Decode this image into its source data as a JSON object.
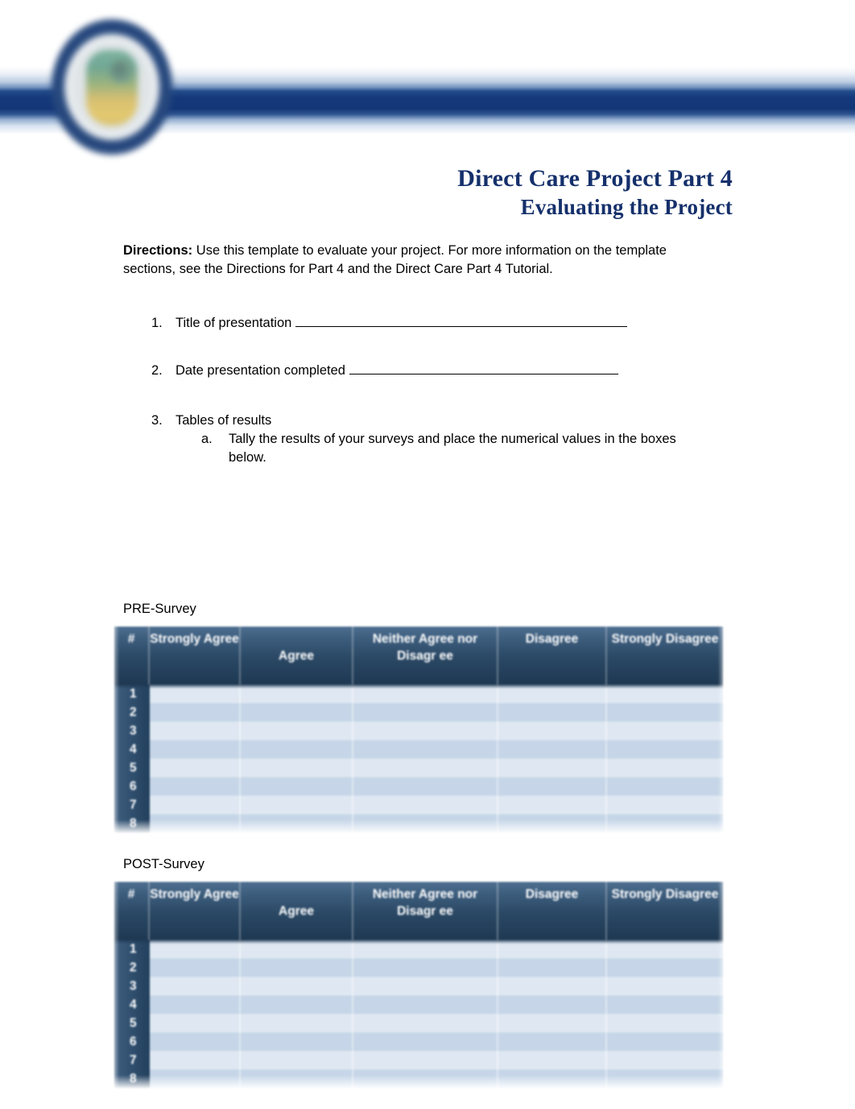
{
  "header": {
    "logo_icon": "circular-shield-emblem-logo",
    "rule_color": "#15397b",
    "title_color": "#15306b"
  },
  "title": {
    "line1": "Direct Care Project Part 4",
    "line2": "Evaluating the Project"
  },
  "directions": {
    "label": "Directions:",
    "text": " Use this template to evaluate your project. For more information on the template sections, see the Directions for Part 4 and the Direct Care Part 4 Tutorial."
  },
  "items": [
    {
      "marker": "1.",
      "text": "Title of presentation"
    },
    {
      "marker": "2.",
      "text": "Date presentation completed"
    },
    {
      "marker": "3.",
      "text": "Tables of results"
    }
  ],
  "subitems": [
    {
      "marker": "a.",
      "text": "Tally the results of your surveys and place the numerical values in the boxes below."
    }
  ],
  "surveys": [
    {
      "label": "PRE-Survey",
      "columns": [
        "#",
        "Strongly Agree",
        "Agree",
        "Neither Agree nor Disagr ee",
        "Disagree",
        "Strongly Disagree"
      ],
      "rows": [
        {
          "num": "1",
          "values": [
            "",
            "",
            "",
            "",
            ""
          ]
        },
        {
          "num": "2",
          "values": [
            "",
            "",
            "",
            "",
            ""
          ]
        },
        {
          "num": "3",
          "values": [
            "",
            "",
            "",
            "",
            ""
          ]
        },
        {
          "num": "4",
          "values": [
            "",
            "",
            "",
            "",
            ""
          ]
        },
        {
          "num": "5",
          "values": [
            "",
            "",
            "",
            "",
            ""
          ]
        },
        {
          "num": "6",
          "values": [
            "",
            "",
            "",
            "",
            ""
          ]
        },
        {
          "num": "7",
          "values": [
            "",
            "",
            "",
            "",
            ""
          ]
        },
        {
          "num": "8",
          "values": [
            "",
            "",
            "",
            "",
            ""
          ]
        }
      ]
    },
    {
      "label": "POST-Survey",
      "columns": [
        "#",
        "Strongly Agree",
        "Agree",
        "Neither Agree nor Disagr ee",
        "Disagree",
        "Strongly Disagree"
      ],
      "rows": [
        {
          "num": "1",
          "values": [
            "",
            "",
            "",
            "",
            ""
          ]
        },
        {
          "num": "2",
          "values": [
            "",
            "",
            "",
            "",
            ""
          ]
        },
        {
          "num": "3",
          "values": [
            "",
            "",
            "",
            "",
            ""
          ]
        },
        {
          "num": "4",
          "values": [
            "",
            "",
            "",
            "",
            ""
          ]
        },
        {
          "num": "5",
          "values": [
            "",
            "",
            "",
            "",
            ""
          ]
        },
        {
          "num": "6",
          "values": [
            "",
            "",
            "",
            "",
            ""
          ]
        },
        {
          "num": "7",
          "values": [
            "",
            "",
            "",
            "",
            ""
          ]
        },
        {
          "num": "8",
          "values": [
            "",
            "",
            "",
            "",
            ""
          ]
        }
      ]
    }
  ],
  "table_style": {
    "header_bg_top": "#4e6f90",
    "header_bg_bottom": "#1e3852",
    "band_light": "#dfe8f2",
    "band_dark": "#c6d6e8",
    "num_col_bg": "#2e4d6c"
  }
}
